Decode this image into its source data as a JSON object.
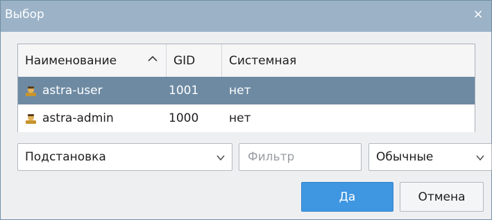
{
  "window": {
    "title": "Выбор",
    "close_glyph": "×"
  },
  "table": {
    "columns": [
      "Наименование",
      "GID",
      "Системная"
    ],
    "sort_indicator": "^",
    "rows": [
      {
        "name": "astra-user",
        "gid": "1001",
        "system": "нет",
        "selected": true,
        "icon": "user-icon"
      },
      {
        "name": "astra-admin",
        "gid": "1000",
        "system": "нет",
        "selected": false,
        "icon": "user-icon"
      }
    ]
  },
  "controls": {
    "substitution_label": "Подстановка",
    "filter_placeholder": "Фильтр",
    "kind_label": "Обычные"
  },
  "buttons": {
    "ok_label": "Да",
    "cancel_label": "Отмена"
  },
  "colors": {
    "title_bar": "#9bb2c7",
    "selected_row": "#6e8aa3",
    "primary_button": "#3f96e1"
  }
}
